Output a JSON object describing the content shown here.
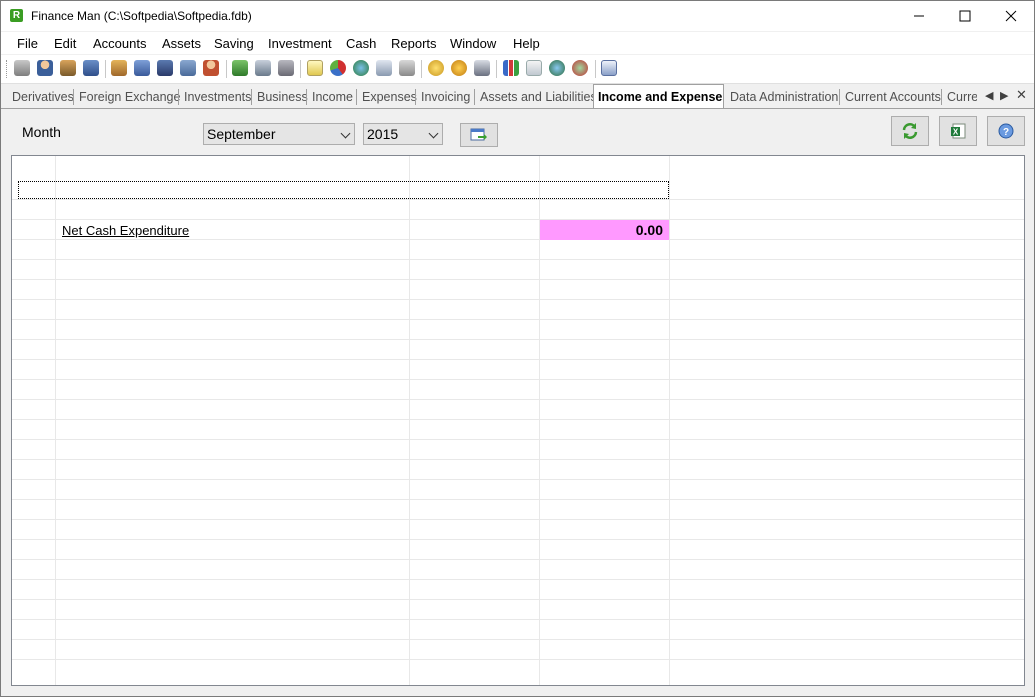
{
  "window": {
    "title": "Finance Man (C:\\Softpedia\\Softpedia.fdb)",
    "app_icon_letter": "R"
  },
  "menu": [
    "File",
    "Edit",
    "Accounts",
    "Assets",
    "Saving",
    "Investment",
    "Cash",
    "Reports",
    "Window",
    "Help"
  ],
  "toolbar_icons": [
    "building-icon",
    "person-icon",
    "house-money-icon",
    "car-money-icon",
    "house-icon",
    "car-icon",
    "truck-icon",
    "computer-icon",
    "person-card-icon",
    "money-stack-icon",
    "printer-icon",
    "scanner-icon",
    "new-document-icon",
    "pie-chart-icon",
    "globe-icon",
    "document-icon",
    "safe-icon",
    "coins-icon",
    "coins-star-icon",
    "calculator-icon",
    "bar-chart-icon",
    "export-document-icon",
    "globe-search-icon",
    "globe-refresh-icon",
    "card-icon"
  ],
  "tabs": [
    "Derivatives",
    "Foreign Exchange",
    "Investments",
    "Business",
    "Income",
    "Expenses",
    "Invoicing",
    "Assets and Liabilities",
    "Income and Expenses",
    "Data Administration",
    "Current Accounts",
    "Curre"
  ],
  "active_tab": "Income and Expenses",
  "filters": {
    "month_label": "Month",
    "month_value": "September",
    "year_value": "2015"
  },
  "report": {
    "rows": [
      {
        "label": "Net Cash Expenditure",
        "value": "0.00",
        "highlight_color": "#ff99ff"
      }
    ]
  },
  "colors": {
    "accent_tab_border": "#a0a0a0",
    "highlight": "#ff99ff"
  }
}
